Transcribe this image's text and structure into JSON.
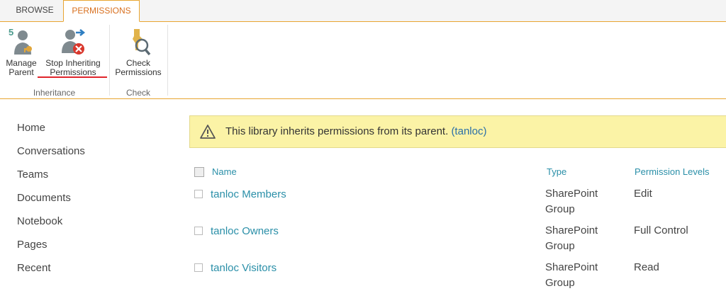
{
  "tabs": {
    "browse": "BROWSE",
    "permissions": "PERMISSIONS"
  },
  "ribbon": {
    "manage_parent": "Manage\nParent",
    "stop_inheriting": "Stop Inheriting\nPermissions",
    "check_permissions": "Check\nPermissions",
    "group_inheritance": "Inheritance",
    "group_check": "Check"
  },
  "nav": [
    "Home",
    "Conversations",
    "Teams",
    "Documents",
    "Notebook",
    "Pages",
    "Recent"
  ],
  "banner": {
    "text": "This library inherits permissions from its parent.",
    "link": "(tanloc)"
  },
  "table": {
    "headers": {
      "name": "Name",
      "type": "Type",
      "levels": "Permission Levels"
    },
    "rows": [
      {
        "name": "tanloc Members",
        "type": "SharePoint\nGroup",
        "level": "Edit"
      },
      {
        "name": "tanloc Owners",
        "type": "SharePoint\nGroup",
        "level": "Full Control"
      },
      {
        "name": "tanloc Visitors",
        "type": "SharePoint\nGroup",
        "level": "Read"
      }
    ]
  },
  "icons": {
    "manage_parent": "manage-parent-icon",
    "stop_inheriting": "stop-inheriting-icon",
    "check_permissions": "check-permissions-icon",
    "warning": "warning-icon"
  },
  "colors": {
    "accent": "#e8a531",
    "link": "#2a8fa8",
    "banner": "#fbf3a6",
    "underline": "#e0242b"
  }
}
